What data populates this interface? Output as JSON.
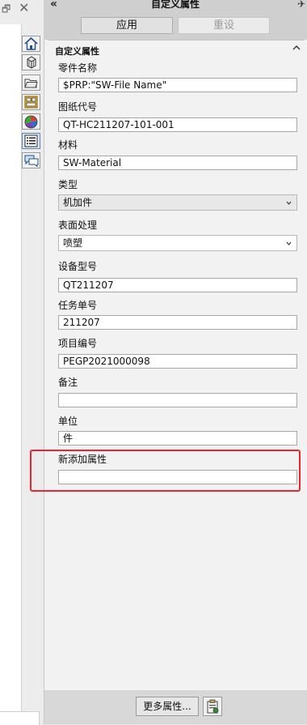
{
  "window": {
    "restore_glyph": "🗗",
    "close_glyph": "✕"
  },
  "header": {
    "collapse_glyph": "«",
    "title": "自定义属性",
    "pin_glyph": "✈"
  },
  "toolbar": {
    "apply_label": "应用",
    "reset_label": "重设"
  },
  "vertical_tabs": [
    {
      "icon": "home-icon"
    },
    {
      "icon": "part-icon"
    },
    {
      "icon": "folder-icon"
    },
    {
      "icon": "view-palette-icon"
    },
    {
      "icon": "appearance-icon"
    },
    {
      "icon": "custom-properties-icon"
    },
    {
      "icon": "forum-icon"
    }
  ],
  "group": {
    "title": "自定义属性",
    "collapsed": false
  },
  "fields": {
    "part_name": {
      "label": "零件名称",
      "value": "$PRP:\"SW-File Name\""
    },
    "drawing_no": {
      "label": "图纸代号",
      "value": "QT-HC211207-101-001"
    },
    "material": {
      "label": "材料",
      "value": "SW-Material"
    },
    "type": {
      "label": "类型",
      "value": "机加件"
    },
    "surface": {
      "label": "表面处理",
      "value": "喷塑"
    },
    "equipment_model": {
      "label": "设备型号",
      "value": "QT211207"
    },
    "task_no": {
      "label": "任务单号",
      "value": "211207"
    },
    "project_no": {
      "label": "项目编号",
      "value": "PEGP2021000098"
    },
    "remark": {
      "label": "备注",
      "value": ""
    },
    "unit": {
      "label": "单位",
      "value": "件"
    },
    "new_attr": {
      "label": "新添加属性",
      "value": ""
    }
  },
  "footer": {
    "more_props_label": "更多属性..."
  },
  "colors": {
    "highlight": "#e8262b",
    "panel_bg": "#f2f2f2",
    "toolbar_bg": "#cfcfcf"
  }
}
